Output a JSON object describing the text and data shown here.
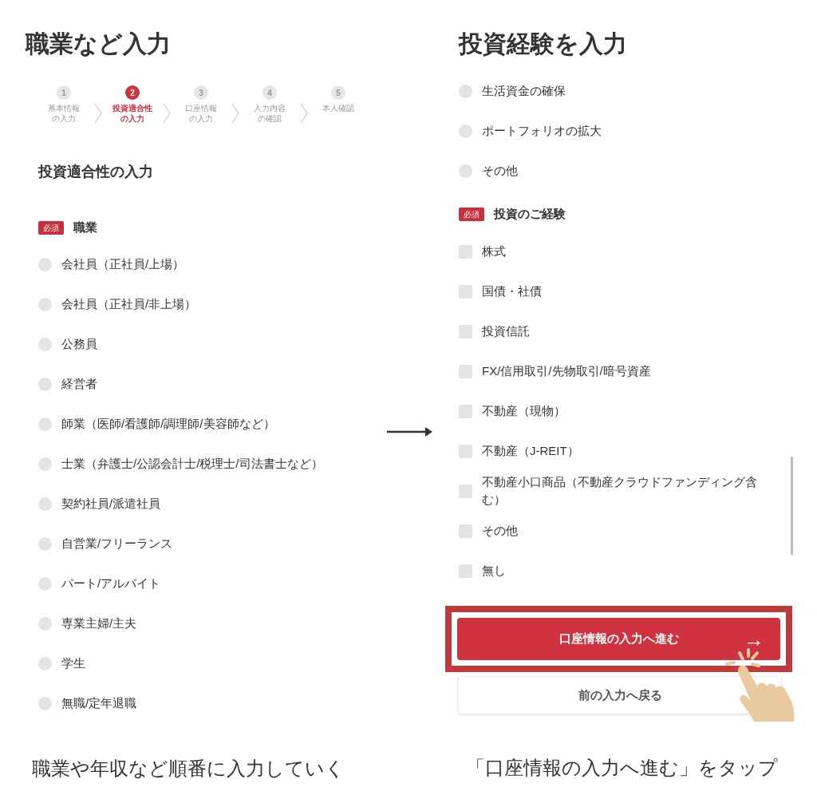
{
  "left": {
    "title": "職業など入力",
    "steps": [
      {
        "number": "1",
        "lines": [
          "基本情報",
          "の入力"
        ],
        "selected": false
      },
      {
        "number": "2",
        "lines": [
          "投資適合性",
          "の入力"
        ],
        "selected": true
      },
      {
        "number": "3",
        "lines": [
          "口座情報",
          "の入力"
        ],
        "selected": false
      },
      {
        "number": "4",
        "lines": [
          "入力内容",
          "の確認"
        ],
        "selected": false
      },
      {
        "number": "5",
        "lines": [
          "本人確認"
        ],
        "selected": false
      }
    ],
    "section_title": "投資適合性の入力",
    "question": {
      "badge": "必須",
      "label": "職業"
    },
    "options": [
      {
        "label": "会社員（正社員/上場）",
        "selected": false
      },
      {
        "label": "会社員（正社員/非上場）",
        "selected": false
      },
      {
        "label": "公務員",
        "selected": false
      },
      {
        "label": "経営者",
        "selected": false
      },
      {
        "label": "師業（医師/看護師/調理師/美容師など）",
        "selected": false
      },
      {
        "label": "士業（弁護士/公認会計士/税理士/司法書士など）",
        "selected": false
      },
      {
        "label": "契約社員/派遣社員",
        "selected": false
      },
      {
        "label": "自営業/フリーランス",
        "selected": false
      },
      {
        "label": "パート/アルバイト",
        "selected": false
      },
      {
        "label": "専業主婦/主夫",
        "selected": false
      },
      {
        "label": "学生",
        "selected": false
      },
      {
        "label": "無職/定年退職",
        "selected": false
      }
    ],
    "caption": "職業や年収など順番に入力していく"
  },
  "right": {
    "title": "投資経験を入力",
    "options": [
      {
        "label": "生活資金の確保",
        "selected": false
      },
      {
        "label": "ポートフォリオの拡大",
        "selected": false
      },
      {
        "label": "その他",
        "selected": false
      }
    ],
    "question": {
      "badge": "必須",
      "label": "投資のご経験"
    },
    "checkboxes": [
      {
        "label": "株式",
        "checked": false
      },
      {
        "label": "国債・社債",
        "checked": false
      },
      {
        "label": "投資信託",
        "checked": false
      },
      {
        "label": "FX/信用取引/先物取引/暗号資産",
        "checked": false
      },
      {
        "label": "不動産（現物）",
        "checked": false
      },
      {
        "label": "不動産（J-REIT）",
        "checked": false
      },
      {
        "label": "不動産小口商品（不動産クラウドファンディング含む）",
        "checked": false
      },
      {
        "label": "その他",
        "checked": false
      },
      {
        "label": "無し",
        "checked": false
      }
    ],
    "primary_button": {
      "label": "口座情報の入力へ進む",
      "arrow": "→"
    },
    "secondary_button": {
      "label": "前の入力へ戻る"
    },
    "caption": "「口座情報の入力へ進む」をタップ"
  }
}
